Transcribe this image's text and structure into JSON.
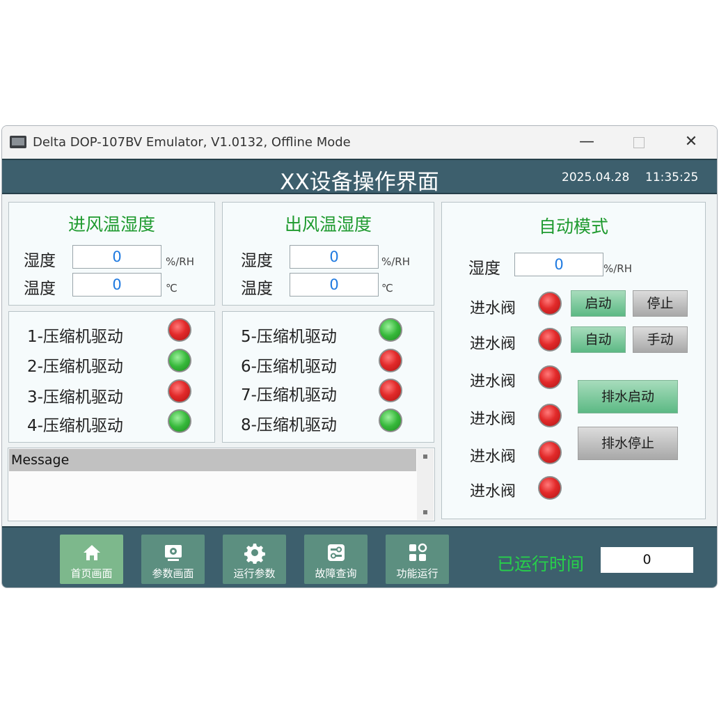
{
  "window": {
    "title": "Delta DOP-107BV Emulator, V1.0132, Offline Mode",
    "controls": {
      "minimize": "—",
      "close": "✕"
    }
  },
  "header": {
    "title": "XX设备操作界面",
    "date": "2025.04.28",
    "time": "11:35:25"
  },
  "inlet": {
    "title": "进风温湿度",
    "humidity_label": "湿度",
    "humidity_value": "0",
    "humidity_unit": "%/RH",
    "temperature_label": "温度",
    "temperature_value": "0",
    "temperature_unit": "℃"
  },
  "outlet": {
    "title": "出风温湿度",
    "humidity_label": "湿度",
    "humidity_value": "0",
    "humidity_unit": "%/RH",
    "temperature_label": "温度",
    "temperature_value": "0",
    "temperature_unit": "℃"
  },
  "compressors_left": [
    {
      "label": "1-压缩机驱动",
      "status": "red"
    },
    {
      "label": "2-压缩机驱动",
      "status": "green"
    },
    {
      "label": "3-压缩机驱动",
      "status": "red"
    },
    {
      "label": "4-压缩机驱动",
      "status": "green"
    }
  ],
  "compressors_right": [
    {
      "label": "5-压缩机驱动",
      "status": "green"
    },
    {
      "label": "6-压缩机驱动",
      "status": "red"
    },
    {
      "label": "7-压缩机驱动",
      "status": "red"
    },
    {
      "label": "8-压缩机驱动",
      "status": "green"
    }
  ],
  "auto": {
    "title": "自动模式",
    "humidity_label": "湿度",
    "humidity_value": "0",
    "humidity_unit": "%/RH",
    "valves": [
      {
        "label": "进水阀",
        "status": "red"
      },
      {
        "label": "进水阀",
        "status": "red"
      },
      {
        "label": "进水阀",
        "status": "red"
      },
      {
        "label": "进水阀",
        "status": "red"
      },
      {
        "label": "进水阀",
        "status": "red"
      },
      {
        "label": "进水阀",
        "status": "red"
      }
    ],
    "start_label": "启动",
    "stop_label": "停止",
    "auto_label": "自动",
    "manual_label": "手动",
    "drain_start_label": "排水启动",
    "drain_stop_label": "排水停止"
  },
  "message": {
    "header": "Message"
  },
  "footer": {
    "nav": [
      {
        "label": "首页画面",
        "icon": "home-icon"
      },
      {
        "label": "参数画面",
        "icon": "monitor-icon"
      },
      {
        "label": "运行参数",
        "icon": "gear-icon"
      },
      {
        "label": "故障查询",
        "icon": "sliders-icon"
      },
      {
        "label": "功能运行",
        "icon": "grid-icon"
      }
    ],
    "runtime_label": "已运行时间",
    "runtime_value": "0"
  },
  "colors": {
    "header_bg": "#3d5f6d",
    "panel_title": "#1e9a2e",
    "value_blue": "#1f7ae0",
    "runtime_green": "#27d04a",
    "lamp_red": "#e22a2a",
    "lamp_green": "#36b83a"
  }
}
